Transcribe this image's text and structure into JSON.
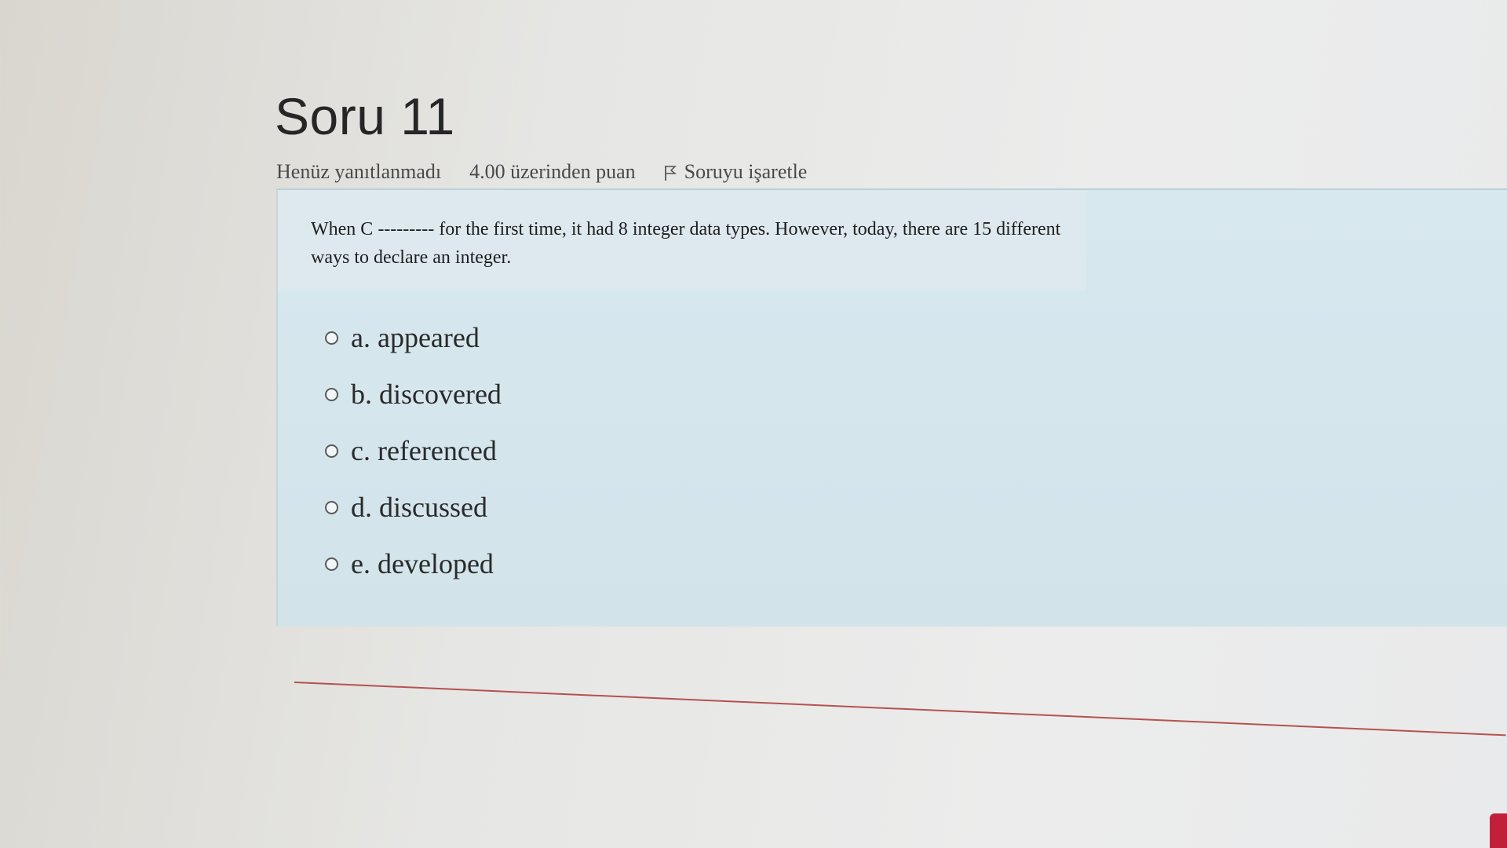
{
  "question": {
    "title": "Soru 11",
    "status": "Henüz yanıtlanmadı",
    "points": "4.00 üzerinden puan",
    "flag_label": "Soruyu işaretle",
    "flag_icon": "flag-icon",
    "text": "When C --------- for the first time, it had 8 integer data types. However, today, there are 15 different ways to declare an integer."
  },
  "options": [
    {
      "label": "a. appeared",
      "selected": false
    },
    {
      "label": "b. discovered",
      "selected": false
    },
    {
      "label": "c. referenced",
      "selected": false
    },
    {
      "label": "d. discussed",
      "selected": false
    },
    {
      "label": "e. developed",
      "selected": false
    }
  ],
  "colors": {
    "question_box": "#d8e8ef",
    "divider": "#b5524f",
    "accent": "#c0203a"
  }
}
